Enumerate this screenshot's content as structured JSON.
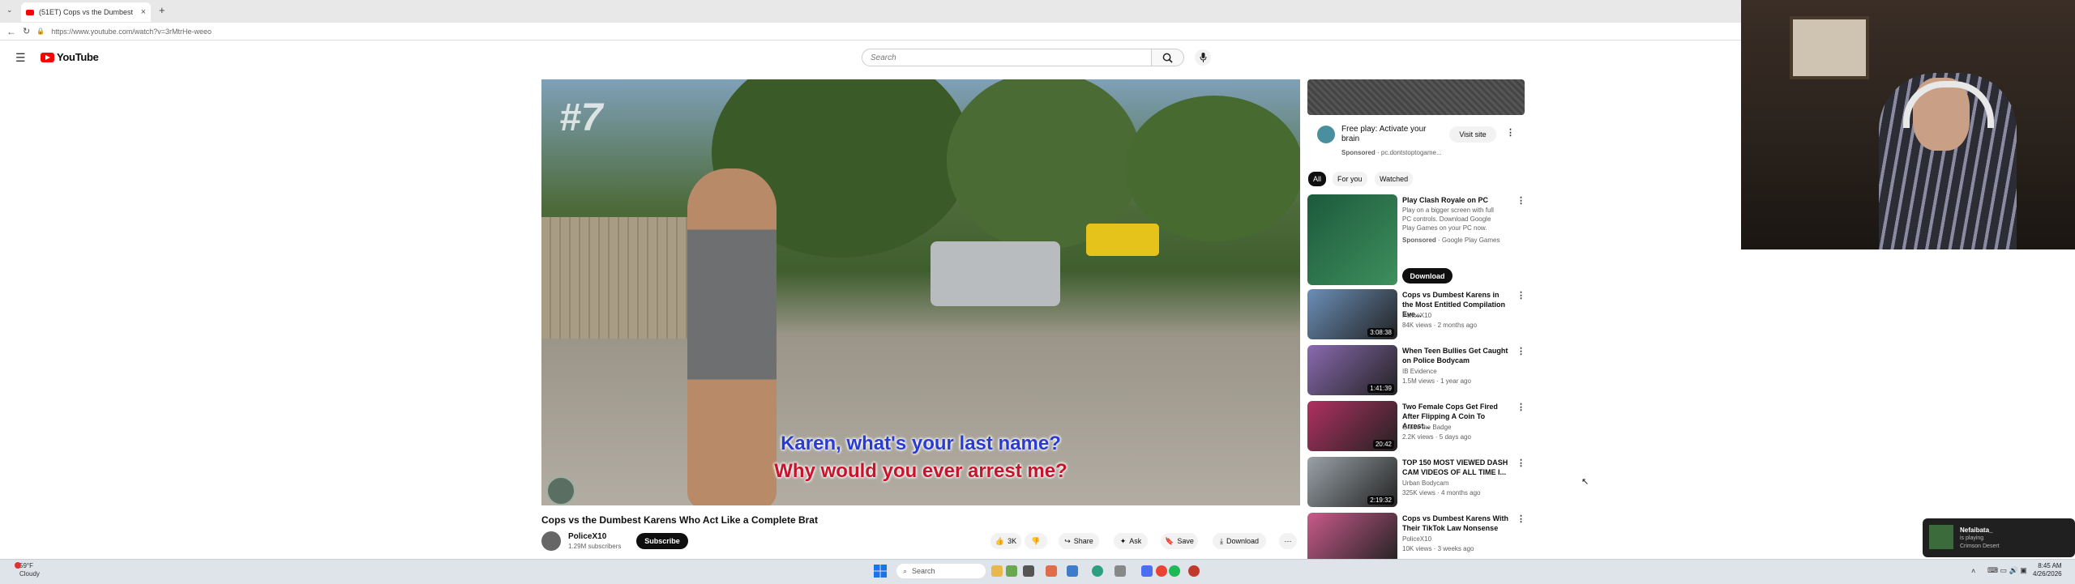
{
  "browser": {
    "tab_title": "(51ET) Cops vs the Dumbest",
    "url": "https://www.youtube.com/watch?v=3rMtrHe-weeo"
  },
  "youtube": {
    "logo_text": "YouTube",
    "search_placeholder": "Search"
  },
  "video": {
    "badge": "#7",
    "caption_line1": "Karen, what's your last name?",
    "caption_line2": "Why would you ever arrest me?",
    "title": "Cops vs the Dumbest Karens Who Act Like a Complete Brat",
    "channel_name": "PoliceX10",
    "channel_subs": "1.29M subscribers",
    "subscribe_label": "Subscribe",
    "likes": "3K",
    "share_label": "Share",
    "ask_label": "Ask",
    "save_label": "Save",
    "download_label": "Download"
  },
  "sidebar": {
    "ad": {
      "title": "Free play: Activate your brain",
      "sponsored": "Sponsored",
      "domain": "· pc.dontstoptogame...",
      "visit_label": "Visit site"
    },
    "chips": [
      "All",
      "For you",
      "Watched"
    ],
    "sponsored_item": {
      "title": "Play Clash Royale on PC",
      "desc": "Play on a bigger screen with full PC controls. Download Google Play Games on your PC now.",
      "sponsored": "Sponsored",
      "advertiser": "· Google Play Games",
      "download_label": "Download"
    },
    "items": [
      {
        "title": "Cops vs Dumbest Karens in the Most Entitled Compilation Eve...",
        "channel": "PoliceX10",
        "meta": "84K views · 2 months ago",
        "duration": "3:08:38",
        "color": "#6b8fb8"
      },
      {
        "title": "When Teen Bullies Get Caught on Police Bodycam",
        "channel": "IB Evidence",
        "meta": "1.5M views · 1 year ago",
        "duration": "1:41:39",
        "color": "#8a6ab0"
      },
      {
        "title": "Two Female Cops Get Fired After Flipping A Coin To Arrest...",
        "channel": "Grace the Badge",
        "meta": "2.2K views · 5 days ago",
        "duration": "20:42",
        "color": "#b03060"
      },
      {
        "title": "TOP 150 MOST VIEWED DASH CAM VIDEOS OF ALL TIME I...",
        "channel": "Urban Bodycam",
        "meta": "325K views · 4 months ago",
        "duration": "2:19:32",
        "color": "#9aa2a8"
      },
      {
        "title": "Cops vs Dumbest Karens With Their TikTok Law Nonsense",
        "channel": "PoliceX10",
        "meta": "10K views · 3 weeks ago",
        "duration": "",
        "color": "#c85a8a"
      }
    ]
  },
  "music": {
    "title": "Nefaibata_",
    "status": "is playing",
    "track": "Crimson Desert"
  },
  "taskbar": {
    "weather_temp": "59°F",
    "weather_desc": "Cloudy",
    "search_label": "Search",
    "time": "8:45 AM",
    "date": "4/26/2026"
  }
}
